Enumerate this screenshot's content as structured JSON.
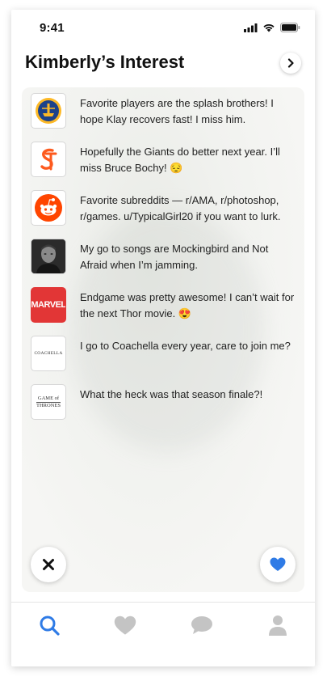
{
  "status_bar": {
    "time": "9:41"
  },
  "header": {
    "title": "Kimberly’s Interest"
  },
  "interests": [
    {
      "logo": "warriors-logo",
      "text": "Favorite players are the splash brothers! I hope Klay recovers fast! I miss him."
    },
    {
      "logo": "giants-logo",
      "text": "Hopefully the Giants do better next year. I’ll miss Bruce Bochy! 😔"
    },
    {
      "logo": "reddit-logo",
      "text": "Favorite subreddits — r/AMA, r/photoshop, r/games. u/TypicalGirl20 if you want to lurk."
    },
    {
      "logo": "eminem-photo",
      "text": "My go to songs are Mockingbird and Not Afraid when I’m jamming."
    },
    {
      "logo": "marvel-logo",
      "text": "Endgame was pretty awesome! I can’t wait for the next Thor movie. 😍"
    },
    {
      "logo": "coachella-logo",
      "text": "I go to Coachella every year, care to join me?"
    },
    {
      "logo": "got-logo",
      "text": "What the heck was that season finale?!"
    }
  ],
  "logo_text": {
    "marvel": "MARVEL",
    "coachella": "COACHELLA",
    "got_line1": "GAME of",
    "got_line2": "THRONES"
  },
  "actions": {
    "dismiss_icon": "close-icon",
    "like_icon": "heart-icon"
  },
  "tabbar": {
    "items": [
      {
        "icon": "search-icon",
        "active": true
      },
      {
        "icon": "heart-icon",
        "active": false
      },
      {
        "icon": "chat-icon",
        "active": false
      },
      {
        "icon": "profile-icon",
        "active": false
      }
    ]
  },
  "colors": {
    "accent": "#2f7be6",
    "inactive_tab": "#c4c4c4",
    "warriors_blue": "#1d428a",
    "warriors_gold": "#fdb927",
    "giants_orange": "#fd5a1e",
    "reddit_orange": "#ff4500",
    "marvel_red": "#e23636"
  }
}
